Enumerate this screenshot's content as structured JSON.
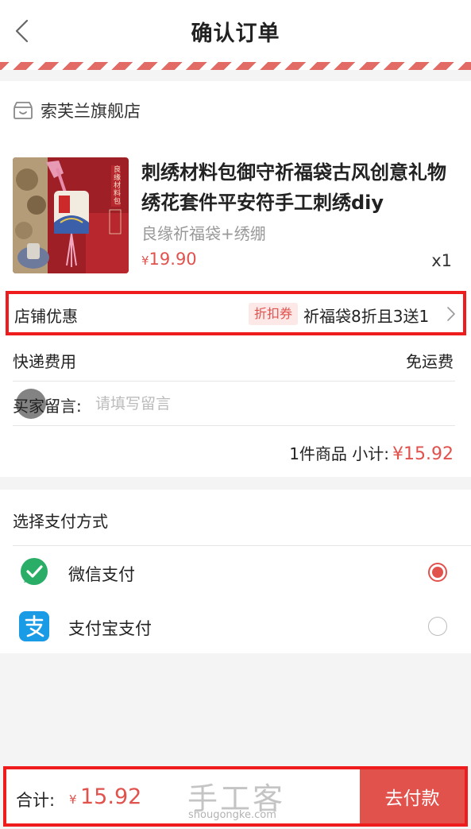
{
  "header": {
    "title": "确认订单",
    "back_icon": "chevron-left-icon"
  },
  "store": {
    "name": "索芙兰旗舰店",
    "icon": "store-icon"
  },
  "product": {
    "title": "刺绣材料包御守祈福袋古风创意礼物绣花套件平安符手工刺绣diy",
    "spec": "良缘祈福袋+绣绷",
    "price_symbol": "¥",
    "price": "19.90",
    "quantity": "x1",
    "image_caption": "良缘材料包"
  },
  "discount": {
    "label": "店铺优惠",
    "tag": "折扣券",
    "text": "祈福袋8折且3送1"
  },
  "shipping": {
    "label": "快递费用",
    "value": "免运费"
  },
  "message": {
    "label": "买家留言:",
    "placeholder": "请填写留言"
  },
  "subtotal": {
    "text": "1件商品 小计:",
    "amount": "¥15.92"
  },
  "payment": {
    "title": "选择支付方式",
    "options": [
      {
        "name": "微信支付",
        "icon": "wechat-pay-icon",
        "selected": true
      },
      {
        "name": "支付宝支付",
        "icon": "alipay-icon",
        "selected": false
      }
    ]
  },
  "footer": {
    "total_label": "合计:",
    "total_symbol": "¥",
    "total_amount": "15.92",
    "pay_button": "去付款"
  },
  "watermark": {
    "main": "手工客",
    "sub": "shougongke.com"
  },
  "colors": {
    "accent": "#e1524d",
    "highlight_border": "#ee1c1c",
    "wechat_green": "#2aae67",
    "alipay_blue": "#1a9be6"
  }
}
